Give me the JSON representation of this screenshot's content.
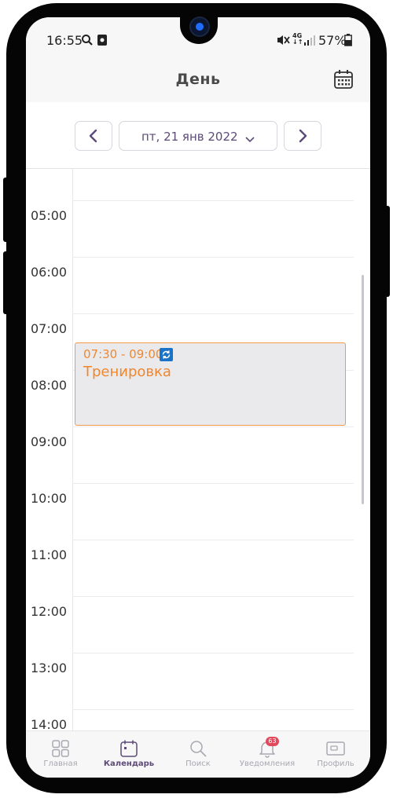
{
  "status_bar": {
    "time": "16:55",
    "network": "4G",
    "battery": "57%"
  },
  "header": {
    "title": "День",
    "calendar_icon": "calendar-grid-icon"
  },
  "date_nav": {
    "date": "пт, 21 янв 2022",
    "prev_icon": "chevron-left-icon",
    "next_icon": "chevron-right-icon"
  },
  "day_view": {
    "hours": [
      "05:00",
      "06:00",
      "07:00",
      "08:00",
      "09:00",
      "10:00",
      "11:00",
      "12:00",
      "13:00",
      "14:00"
    ],
    "event": {
      "time": "07:30 - 09:00",
      "title": "Тренировка",
      "repeat_icon": "repeat-icon"
    }
  },
  "bottom_nav": {
    "tabs": [
      {
        "label": "Главная",
        "icon": "home-grid-icon",
        "active": false
      },
      {
        "label": "Календарь",
        "icon": "calendar-icon",
        "active": true
      },
      {
        "label": "Поиск",
        "icon": "search-icon",
        "active": false
      },
      {
        "label": "Уведомления",
        "icon": "bell-icon",
        "active": false,
        "badge": "63"
      },
      {
        "label": "Профиль",
        "icon": "profile-card-icon",
        "active": false
      }
    ]
  },
  "colors": {
    "accent": "#5c4b78",
    "event": "#f0872e",
    "badge": "#e24a5c"
  }
}
